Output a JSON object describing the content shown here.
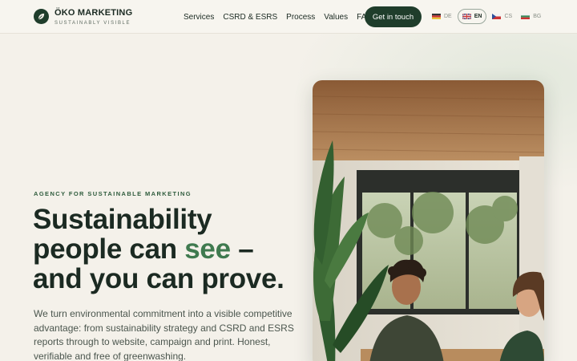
{
  "brand": {
    "name": "ÖKO MARKETING",
    "tagline": "SUSTAINABLY VISIBLE",
    "logo_icon": "leaf-icon"
  },
  "nav": {
    "items": [
      {
        "label": "Services"
      },
      {
        "label": "CSRD & ESRS"
      },
      {
        "label": "Process"
      },
      {
        "label": "Values"
      },
      {
        "label": "FAQ"
      }
    ],
    "cta_label": "Get in touch"
  },
  "languages": [
    {
      "code": "DE",
      "flag": "germany-flag-icon",
      "active": false
    },
    {
      "code": "EN",
      "flag": "uk-flag-icon",
      "active": true
    },
    {
      "code": "CS",
      "flag": "czech-flag-icon",
      "active": false
    },
    {
      "code": "BG",
      "flag": "bulgaria-flag-icon",
      "active": false
    }
  ],
  "hero": {
    "eyebrow": "AGENCY FOR SUSTAINABLE MARKETING",
    "headline_part1": "Sustainability people can ",
    "headline_accent": "see",
    "headline_part2": " – and you can prove.",
    "lead": "We turn environmental commitment into a visible competitive advantage: from sustainability strategy and CSRD and ESRS reports through to website, campaign and print. Honest, verifiable and free of greenwashing."
  },
  "colors": {
    "brand_green": "#1f3d2b",
    "accent_green": "#3f7a4f",
    "background": "#f4f1ea"
  }
}
